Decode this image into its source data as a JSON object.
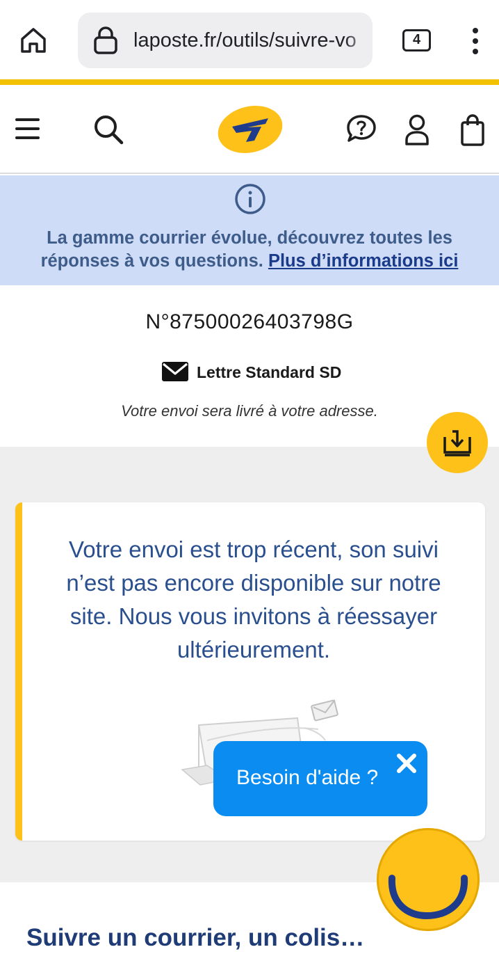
{
  "browser": {
    "url": "laposte.fr/outils/suivre-vo",
    "tab_count": "4",
    "icons": [
      "home-icon",
      "lock-icon",
      "tabs-icon",
      "more-vert-icon"
    ]
  },
  "header": {
    "icons": [
      "menu-icon",
      "search-icon",
      "la-poste-logo",
      "help-chat-icon",
      "account-icon",
      "bag-icon"
    ]
  },
  "banner": {
    "text": "La gamme courrier évolue, découvrez toutes les réponses à vos questions.",
    "link": "Plus d’informations ici",
    "icon": "info-icon"
  },
  "tracking": {
    "number": "N°87500026403798G",
    "type": "Lettre Standard SD",
    "delivery_note": "Votre envoi sera livré à votre adresse."
  },
  "message": {
    "text": "Votre envoi est trop récent, son suivi n’est pas encore disponible sur notre site. Nous vous invitons à réessayer ultérieurement."
  },
  "help_popup": {
    "text": "Besoin d'aide ?"
  },
  "section": {
    "title": "Suivre un courrier, un colis…"
  },
  "colors": {
    "brand_yellow": "#fdc11a",
    "brand_blue": "#1f3c77",
    "banner_bg": "#cfdcf7",
    "help_blue": "#0a8cf0"
  }
}
